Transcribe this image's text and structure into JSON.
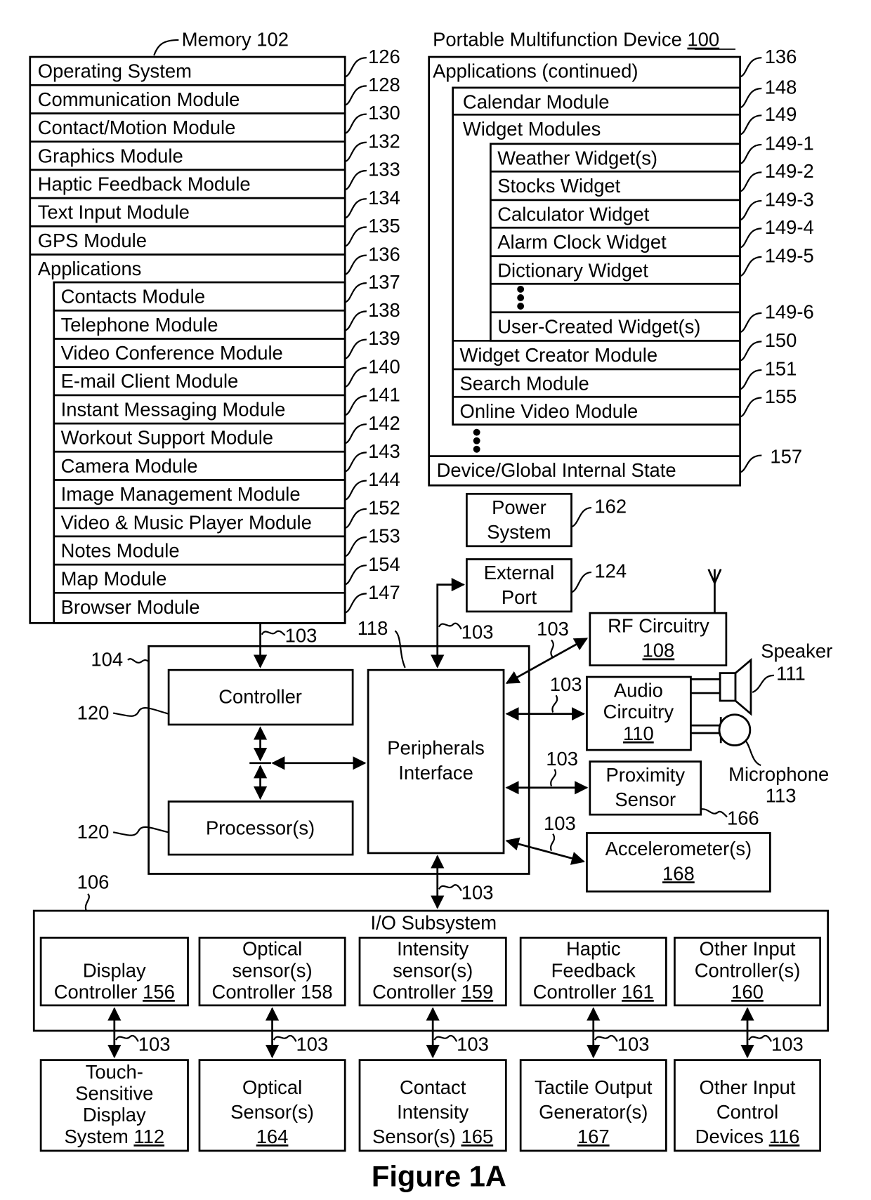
{
  "figure": {
    "caption": "Figure 1A"
  },
  "memory": {
    "label": "Memory 102",
    "rows": [
      {
        "label": "Operating System",
        "ref": "126"
      },
      {
        "label": "Communication Module",
        "ref": "128"
      },
      {
        "label": "Contact/Motion Module",
        "ref": "130"
      },
      {
        "label": "Graphics Module",
        "ref": "132"
      },
      {
        "label": "Haptic Feedback Module",
        "ref": "133"
      },
      {
        "label": "Text Input Module",
        "ref": "134"
      },
      {
        "label": "GPS Module",
        "ref": "135"
      },
      {
        "label": "Applications",
        "ref": "136"
      }
    ],
    "apps": [
      {
        "label": "Contacts Module",
        "ref": "137"
      },
      {
        "label": "Telephone Module",
        "ref": "138"
      },
      {
        "label": "Video Conference Module",
        "ref": "139"
      },
      {
        "label": "E-mail Client Module",
        "ref": "140"
      },
      {
        "label": "Instant Messaging Module",
        "ref": "141"
      },
      {
        "label": "Workout Support Module",
        "ref": "142"
      },
      {
        "label": "Camera Module",
        "ref": "143"
      },
      {
        "label": "Image Management Module",
        "ref": "144"
      },
      {
        "label": "Video & Music Player Module",
        "ref": "152"
      },
      {
        "label": "Notes Module",
        "ref": "153"
      },
      {
        "label": "Map Module",
        "ref": "154"
      },
      {
        "label": "Browser Module",
        "ref": "147"
      }
    ]
  },
  "device": {
    "label": "Portable Multifunction Device",
    "ref": "100",
    "apps_continued": {
      "label": "Applications (continued)",
      "ref": "136"
    },
    "calendar": {
      "label": "Calendar Module",
      "ref": "148"
    },
    "widgets": {
      "label": "Widget Modules",
      "ref": "149"
    },
    "widget_items": [
      {
        "label": "Weather Widget(s)",
        "ref": "149-1"
      },
      {
        "label": "Stocks Widget",
        "ref": "149-2"
      },
      {
        "label": "Calculator Widget",
        "ref": "149-3"
      },
      {
        "label": "Alarm Clock Widget",
        "ref": "149-4"
      },
      {
        "label": "Dictionary Widget",
        "ref": "149-5"
      },
      {
        "label": "User-Created Widget(s)",
        "ref": "149-6"
      }
    ],
    "more_apps": [
      {
        "label": "Widget Creator Module",
        "ref": "150"
      },
      {
        "label": "Search Module",
        "ref": "151"
      },
      {
        "label": "Online Video Module",
        "ref": "155"
      }
    ],
    "state": {
      "label": "Device/Global Internal State",
      "ref": "157"
    }
  },
  "power": {
    "line1": "Power",
    "line2": "System",
    "ref": "162"
  },
  "external_port": {
    "line1": "External",
    "line2": "Port",
    "ref": "124"
  },
  "bus_ref": "103",
  "core": {
    "ref": "104",
    "controller": {
      "label": "Controller",
      "ref": "120"
    },
    "processor": {
      "label": "Processor(s)",
      "ref": "120"
    },
    "peripherals": {
      "line1": "Peripherals",
      "line2": "Interface",
      "ref": "118"
    }
  },
  "rf": {
    "line1": "RF Circuitry",
    "num": "108"
  },
  "audio": {
    "line1": "Audio",
    "line2": "Circuitry",
    "num": "110"
  },
  "speaker": {
    "label": "Speaker",
    "ref": "111"
  },
  "microphone": {
    "label": "Microphone",
    "ref": "113"
  },
  "proximity": {
    "line1": "Proximity",
    "line2": "Sensor",
    "ref": "166"
  },
  "accelerometer": {
    "line1": "Accelerometer(s)",
    "num": "168"
  },
  "io": {
    "label": "I/O Subsystem",
    "ref": "106",
    "controllers": [
      {
        "lines": [
          "Display",
          "Controller"
        ],
        "num": "156",
        "underline": true
      },
      {
        "lines": [
          "Optical",
          "sensor(s)",
          "Controller"
        ],
        "num": "158",
        "underline": false
      },
      {
        "lines": [
          "Intensity",
          "sensor(s)",
          "Controller"
        ],
        "num": "159",
        "underline": true
      },
      {
        "lines": [
          "Haptic",
          "Feedback",
          "Controller"
        ],
        "num": "161",
        "underline": true
      },
      {
        "lines": [
          "Other Input",
          "Controller(s)"
        ],
        "num": "160",
        "underline": true
      }
    ],
    "devices": [
      {
        "lines": [
          "Touch-",
          "Sensitive",
          "Display",
          "System"
        ],
        "num": "112"
      },
      {
        "lines": [
          "Optical",
          "Sensor(s)"
        ],
        "num": "164"
      },
      {
        "lines": [
          "Contact",
          "Intensity",
          "Sensor(s)"
        ],
        "num": "165"
      },
      {
        "lines": [
          "Tactile Output",
          "Generator(s)"
        ],
        "num": "167"
      },
      {
        "lines": [
          "Other Input",
          "Control",
          "Devices"
        ],
        "num": "116"
      }
    ]
  }
}
